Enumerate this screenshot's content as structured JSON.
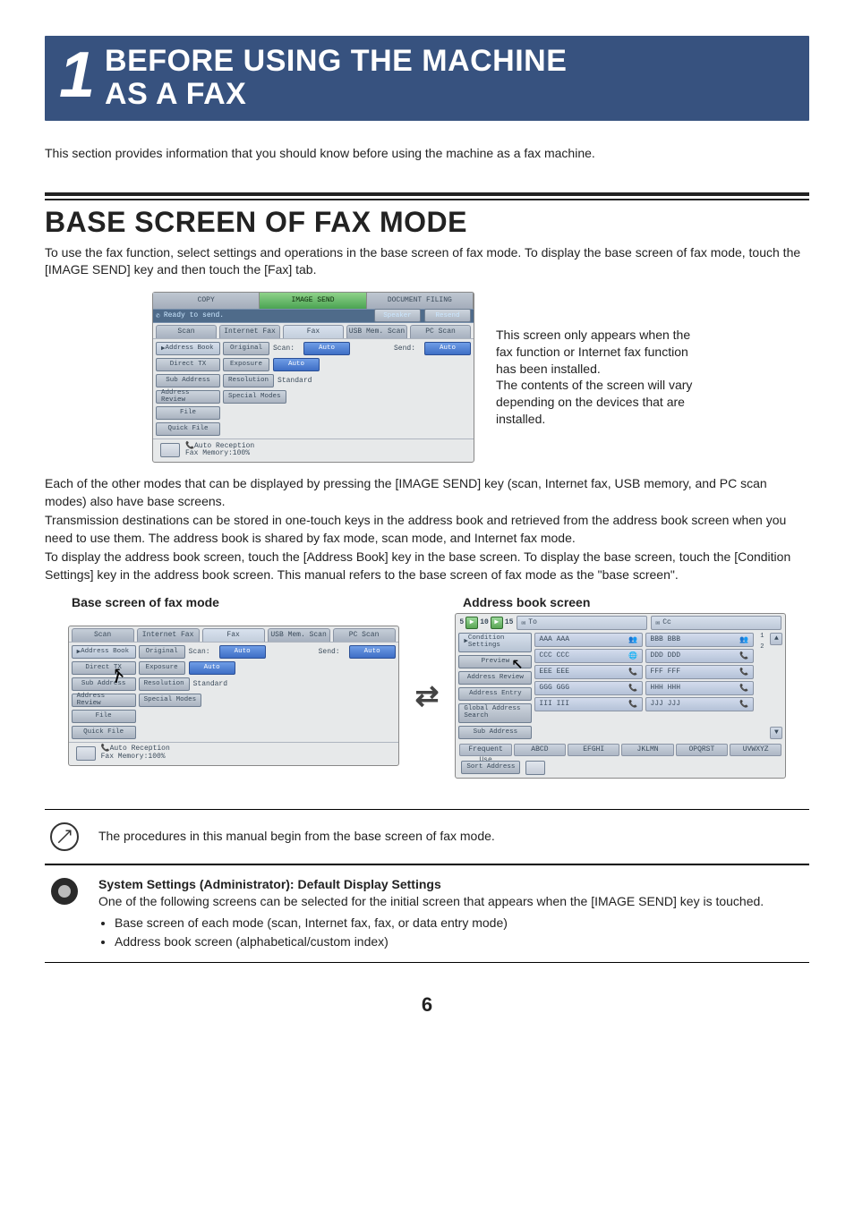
{
  "chapter": {
    "number": "1",
    "title_line1": "BEFORE USING THE MACHINE",
    "title_line2": "AS A FAX"
  },
  "intro": "This section provides information that you should know before using the machine as a fax machine.",
  "section_title": "BASE SCREEN OF FAX MODE",
  "section_lead": "To use the fax function, select settings and operations in the base screen of fax mode. To display the base screen of fax mode, touch the [IMAGE SEND] key and then touch the [Fax] tab.",
  "side_note_1": "This screen only appears when the fax function or Internet fax function has been installed.",
  "side_note_2": "The contents of the screen will vary depending on the devices that are installed.",
  "main_panel": {
    "top_tabs": {
      "copy": "COPY",
      "image_send": "IMAGE SEND",
      "doc_filing": "DOCUMENT FILING"
    },
    "status": {
      "ready": "Ready to send.",
      "speaker": "Speaker",
      "resend": "Resend"
    },
    "mode_tabs": {
      "scan": "Scan",
      "ifax": "Internet Fax",
      "fax": "Fax",
      "usb": "USB Mem. Scan",
      "pc": "PC Scan"
    },
    "left": {
      "address_book": "Address Book",
      "direct_tx": "Direct TX",
      "sub_address": "Sub Address",
      "address_review": "Address Review",
      "file": "File",
      "quick_file": "Quick File"
    },
    "rows": {
      "original_label": "Original",
      "scan_label": "Scan:",
      "auto": "Auto",
      "send_label": "Send:",
      "exposure": "Exposure",
      "resolution": "Resolution",
      "standard": "Standard",
      "special": "Special Modes"
    },
    "footer": {
      "line1": "Auto Reception",
      "line1_prefix": "📞",
      "line2": "Fax Memory:100%"
    }
  },
  "para1": "Each of the other modes that can be displayed by pressing the [IMAGE SEND] key (scan, Internet fax, USB memory, and PC scan modes) also have base screens.",
  "para2": "Transmission destinations can be stored in one-touch keys in the address book and retrieved from the address book screen when you need to use them. The address book is shared by fax mode, scan mode, and Internet fax mode.",
  "para3": "To display the address book screen, touch the [Address Book] key in the base screen. To display the base screen, touch the [Condition Settings] key in the address book screen. This manual refers to the base screen of fax mode as the \"base screen\".",
  "caption_left": "Base screen of fax mode",
  "caption_right": "Address book screen",
  "addr_panel": {
    "nav": {
      "range": "5",
      "arrow1": "▶",
      "mid": "10",
      "arrow2": "▶",
      "end": "15"
    },
    "header": {
      "to": "To",
      "cc": "Cc"
    },
    "left": {
      "cond": "Condition Settings",
      "preview": "Preview",
      "addr_rev": "Address Review",
      "addr_entry": "Address Entry",
      "global": "Global Address Search",
      "sub": "Sub Address"
    },
    "entries": [
      [
        "AAA AAA",
        "BBB BBB"
      ],
      [
        "CCC CCC",
        "DDD DDD"
      ],
      [
        "EEE EEE",
        "FFF FFF"
      ],
      [
        "GGG GGG",
        "HHH HHH"
      ],
      [
        "III III",
        "JJJ JJJ"
      ]
    ],
    "pages": [
      "1",
      "2"
    ],
    "tabs_bot": [
      "Frequent Use",
      "ABCD",
      "EFGHI",
      "JKLMN",
      "OPQRST",
      "UVWXYZ"
    ],
    "sort": "Sort Address"
  },
  "note_text": "The procedures in this manual begin from the base screen of fax mode.",
  "admin": {
    "heading": "System Settings (Administrator): Default Display Settings",
    "line": "One of the following screens can be selected for the initial screen that appears when the [IMAGE SEND] key is touched.",
    "bullet1": "Base screen of each mode (scan, Internet fax, fax, or data entry mode)",
    "bullet2": "Address book screen (alphabetical/custom index)"
  },
  "page_number": "6"
}
